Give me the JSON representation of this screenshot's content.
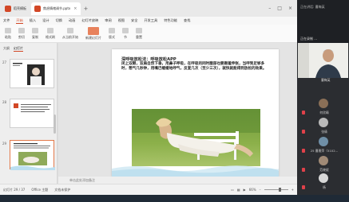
{
  "tabs": [
    {
      "label": "稻壳模板",
      "color": "#d24726"
    },
    {
      "label": "焦虑情绪调节.pptx",
      "color": "#d24726"
    }
  ],
  "menu": [
    "文件",
    "开始",
    "插入",
    "设计",
    "切换",
    "动画",
    "幻灯片放映",
    "审阅",
    "视图",
    "安全",
    "开发工具",
    "特色功能",
    "查找"
  ],
  "menu_active": "开始",
  "ribbon": [
    "粘贴",
    "剪切",
    "复制",
    "格式刷",
    "从当前开始",
    "新建幻灯片",
    "版式",
    "节",
    "重置"
  ],
  "left_panel": {
    "tabs": [
      "大纲",
      "幻灯片"
    ],
    "active": "幻灯片",
    "slide_numbers": [
      "27",
      "28",
      "29"
    ],
    "selected": "29"
  },
  "slide": {
    "title": "深呼吸放松法：呼吸放松APP",
    "body": "闭上双眼，双肩自然下垂，用鼻子呼吸，在呼吸的同时腹部也要跟着伸张，当呼到足够多时，憋气几秒钟，用嘴巴缓缓地呼气，反复几次（至少三次），就快就能得到放松的效果。"
  },
  "notes_placeholder": "单击此处添加备注",
  "status": {
    "slide_pos": "幻灯片 29 / 37",
    "theme": "Office 主题",
    "protect": "文档未保护",
    "zoom": "66%"
  },
  "meeting": {
    "header": "正在讲话: 曹梅英",
    "recording": "正在录制 ...",
    "speaker_name": "曹梅英",
    "participants": [
      "何欣晴",
      "张倩",
      "25 曹雅萍（5102...",
      "范晓斌",
      "杨"
    ]
  },
  "colors": {
    "accent": "#d24726",
    "meeting_bg": "#2b2d31"
  }
}
